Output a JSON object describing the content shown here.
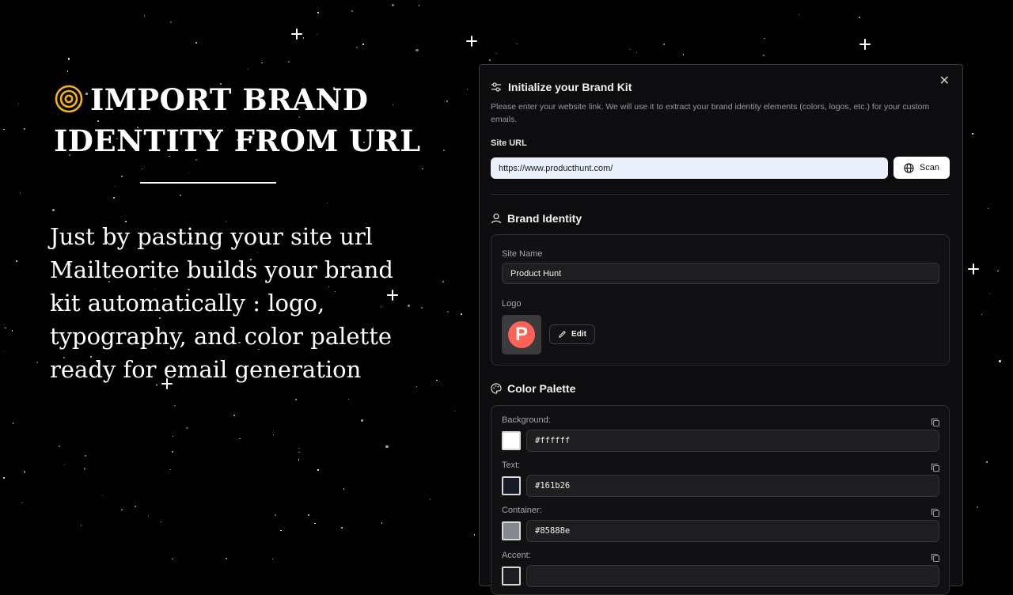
{
  "hero": {
    "title": "IMPORT BRAND IDENTITY FROM URL",
    "body": "Just by pasting your site url Mailteorite builds your brand kit automatically : logo, typography, and color palette ready for email generation"
  },
  "modal": {
    "title": "Initialize your Brand Kit",
    "description": "Please enter your website link. We will use it to extract your brand identity elements (colors, logos, etc.) for your custom emails.",
    "site_url_label": "Site URL",
    "site_url_value": "https://www.producthunt.com/",
    "scan_label": "Scan",
    "brand_identity": {
      "heading": "Brand Identity",
      "site_name_label": "Site Name",
      "site_name_value": "Product Hunt",
      "logo_label": "Logo",
      "logo_letter": "P",
      "edit_label": "Edit"
    },
    "color_palette": {
      "heading": "Color Palette",
      "colors": [
        {
          "label": "Background:",
          "hex": "#ffffff"
        },
        {
          "label": "Text:",
          "hex": "#161b26"
        },
        {
          "label": "Container:",
          "hex": "#85888e"
        },
        {
          "label": "Accent:",
          "hex": ""
        }
      ]
    }
  },
  "colors": {
    "accent": "#f5b21b",
    "product_hunt": "#ff6154"
  }
}
